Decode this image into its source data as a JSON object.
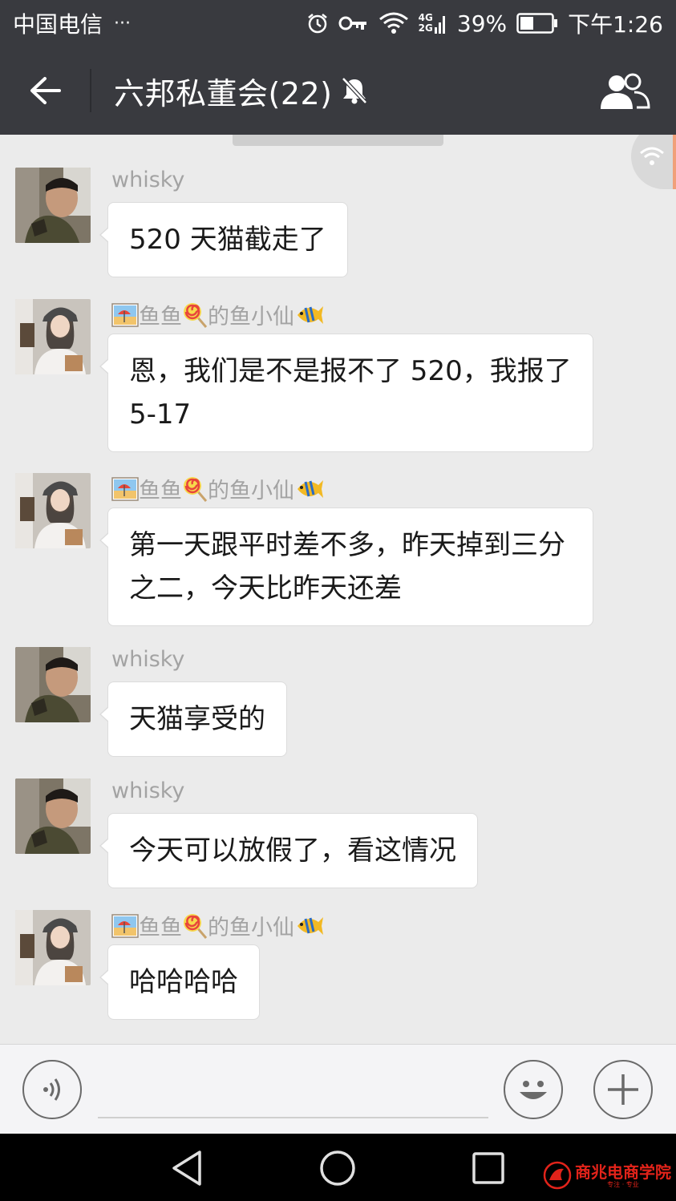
{
  "status_bar": {
    "carrier": "中国电信",
    "more": "···",
    "net_type_top": "4G",
    "net_type_bottom": "2G",
    "battery": "39%",
    "time": "下午1:26"
  },
  "header": {
    "title": "六邦私董会(22)",
    "back_icon": "back-arrow-icon",
    "mute_icon": "bell-muted-icon",
    "group_icon": "group-members-icon"
  },
  "messages": [
    {
      "sender": "whisky",
      "text": "520 天猫截走了",
      "avatar": "man-avatar"
    },
    {
      "sender": "鱼鱼",
      "sender_mid": "的鱼小仙",
      "text": "恩，我们是不是报不了 520，我报了 5-17",
      "avatar": "woman-avatar"
    },
    {
      "sender": "鱼鱼",
      "sender_mid": "的鱼小仙",
      "text": "第一天跟平时差不多，昨天掉到三分之二，今天比昨天还差",
      "avatar": "woman-avatar"
    },
    {
      "sender": "whisky",
      "text": "天猫享受的",
      "avatar": "man-avatar"
    },
    {
      "sender": "whisky",
      "text": "今天可以放假了，看这情况",
      "avatar": "man-avatar"
    },
    {
      "sender": "鱼鱼",
      "sender_mid": "的鱼小仙",
      "text": "哈哈哈哈",
      "avatar": "woman-avatar"
    }
  ],
  "input_bar": {
    "voice_icon": "voice-icon",
    "emoji_icon": "emoji-icon",
    "plus_icon": "plus-icon",
    "placeholder": ""
  },
  "watermark": {
    "text": "商兆电商学院",
    "sub": "专注 · 专业"
  },
  "colors": {
    "title_bar": "#393a3f",
    "chat_bg": "#ebebeb",
    "bubble": "#ffffff",
    "sender_text": "#a3a3a3"
  }
}
